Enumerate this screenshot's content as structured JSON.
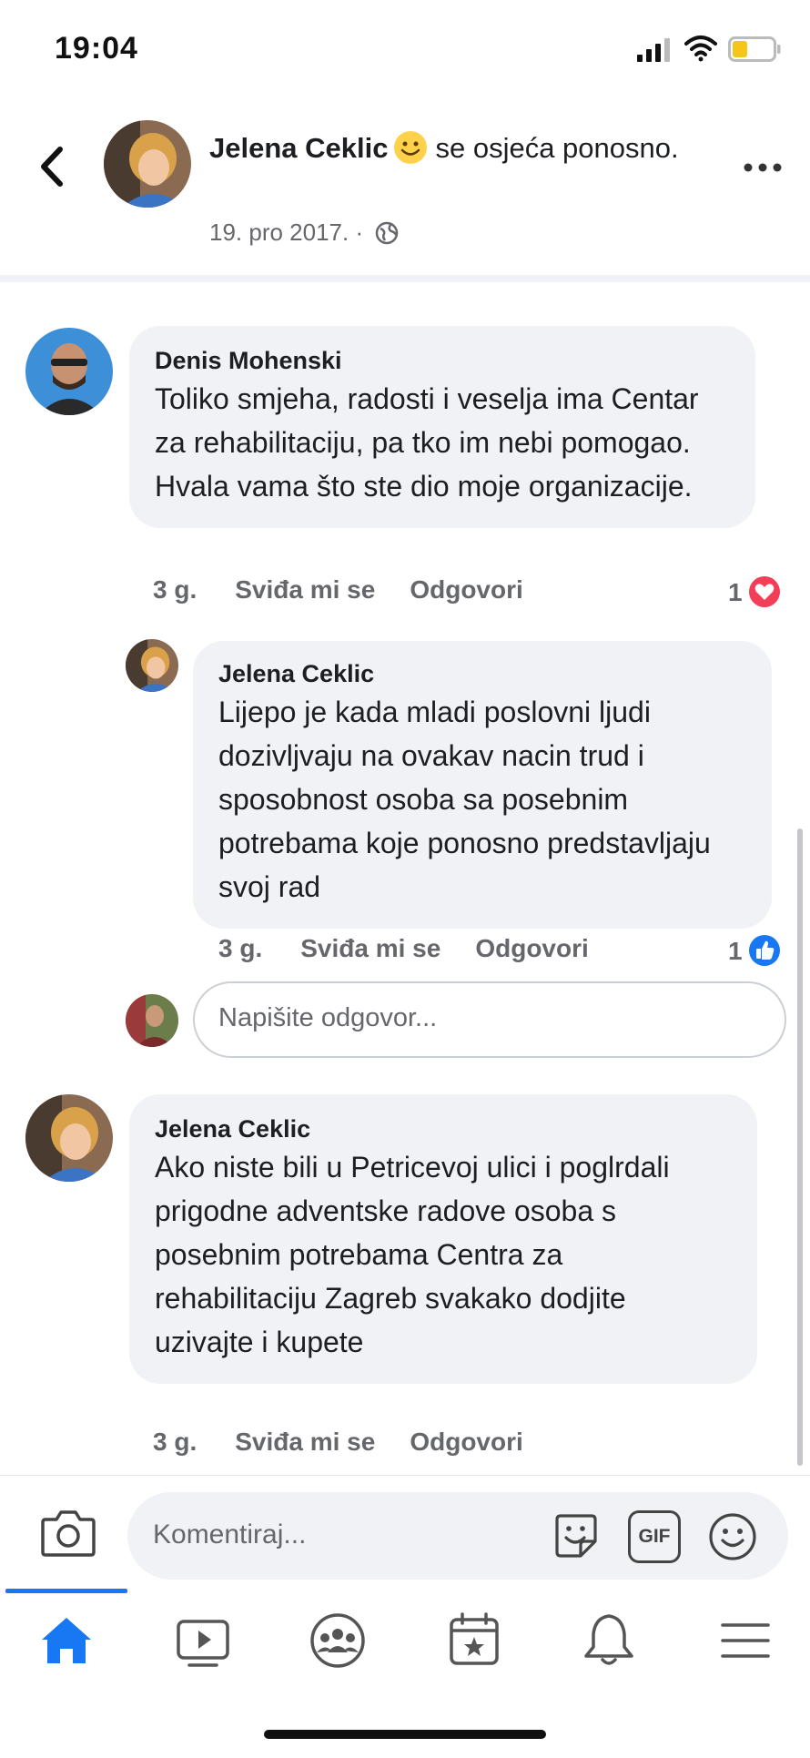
{
  "status_bar": {
    "time": "19:04"
  },
  "post_header": {
    "author": "Jelena Ceklic",
    "feeling_text": "se osjeća ponosno.",
    "date": "19. pro 2017.",
    "separator": "·"
  },
  "comments": [
    {
      "author": "Denis Mohenski",
      "text": "Toliko smjeha, radosti i veselja ima Centar za rehabilitaciju, pa tko im nebi pomogao. Hvala vama što ste dio moje organizacije.",
      "age": "3 g.",
      "like_label": "Sviđa mi se",
      "reply_label": "Odgovori",
      "reaction_count": "1",
      "reaction_icon": "love-reaction-icon",
      "reaction_color": "#f33e58"
    },
    {
      "author": "Jelena Ceklic",
      "text": "Lijepo je kada mladi poslovni ljudi dozivljvaju na ovakav nacin trud i sposobnost osoba sa posebnim potrebama koje ponosno predstavljaju svoj rad",
      "age": "3 g.",
      "like_label": "Sviđa mi se",
      "reply_label": "Odgovori",
      "reaction_count": "1",
      "reaction_icon": "like-reaction-icon",
      "reaction_color": "#1877f2"
    },
    {
      "author": "Jelena Ceklic",
      "text": "Ako niste bili u Petricevoj ulici i poglrdali prigodne adventske radove osoba  s posebnim potrebama Centra za rehabilitaciju Zagreb svakako dodjite uzivajte i kupete",
      "age": "3 g.",
      "like_label": "Sviđa mi se",
      "reply_label": "Odgovori"
    }
  ],
  "reply_input": {
    "placeholder": "Napišite odgovor..."
  },
  "composer": {
    "placeholder": "Komentiraj...",
    "icons": [
      "camera-icon",
      "sticker-icon",
      "gif-icon",
      "emoji-icon"
    ],
    "gif_label": "GIF"
  },
  "tab_bar": {
    "tabs": [
      "home-icon",
      "video-icon",
      "groups-icon",
      "marketplace-icon",
      "notifications-icon",
      "menu-icon"
    ],
    "active": "home-icon",
    "accent_color": "#1877f2"
  }
}
